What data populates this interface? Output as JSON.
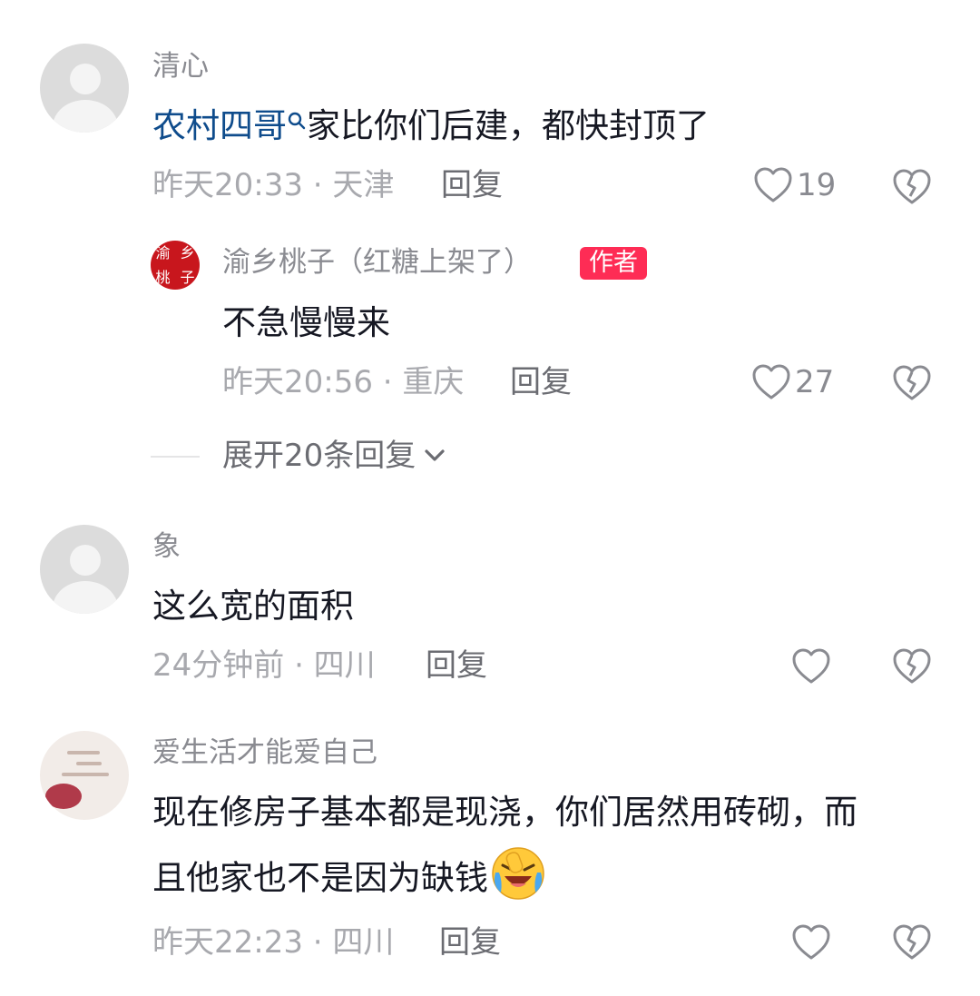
{
  "comments": [
    {
      "username": "清心",
      "mention": "农村四哥",
      "text": "家比你们后建，都快封顶了",
      "meta": "昨天20:33 · 天津",
      "reply_label": "回复",
      "likes": "19",
      "replies": [
        {
          "username": "渝乡桃子（红糖上架了）",
          "badge": "作者",
          "stamp_chars": [
            "渝",
            "乡",
            "桃",
            "子"
          ],
          "text": "不急慢慢来",
          "meta": "昨天20:56 · 重庆",
          "reply_label": "回复",
          "likes": "27"
        }
      ],
      "expand_label": "展开20条回复"
    },
    {
      "username": "象",
      "text": "这么宽的面积",
      "meta": "24分钟前 · 四川",
      "reply_label": "回复",
      "likes": ""
    },
    {
      "username": "爱生活才能爱自己",
      "text_line1": "现在修房子基本都是现浇，你们居然用砖砌，而",
      "text_line2": "且他家也不是因为缺钱",
      "meta": "昨天22:23 · 四川",
      "reply_label": "回复",
      "likes": ""
    }
  ],
  "icons": {
    "like": "heart-outline-icon",
    "dislike": "broken-heart-icon",
    "search_hint": "search-icon",
    "expand": "chevron-down-icon",
    "emoji": "laughing-crying-emoji"
  },
  "colors": {
    "link": "#0f4c8c",
    "badge": "#fe2c55",
    "meta": "#a8a9ae"
  }
}
